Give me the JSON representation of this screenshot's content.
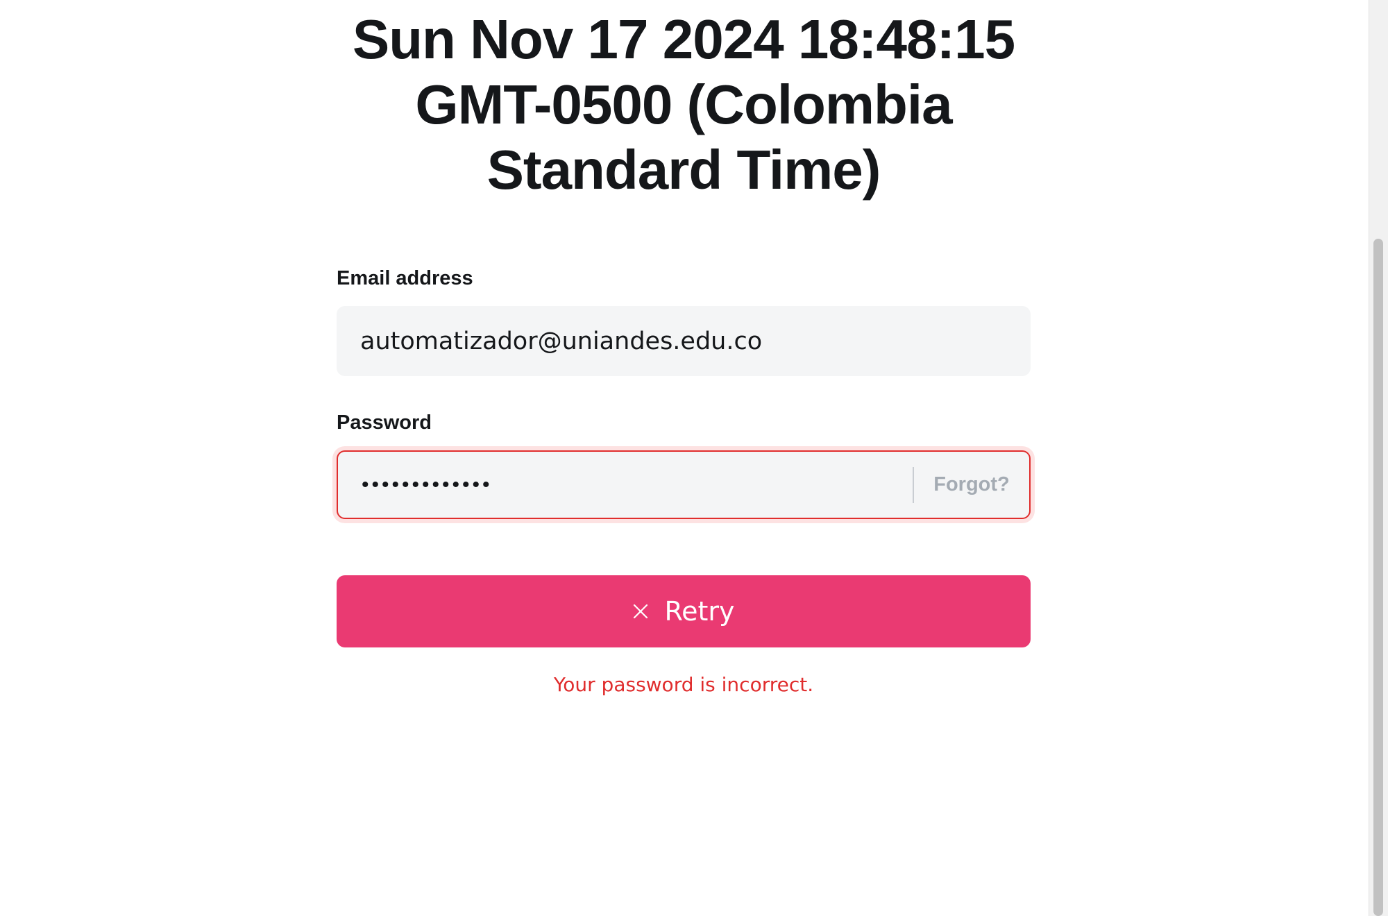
{
  "header": {
    "datetime": "Sun Nov 17 2024 18:48:15 GMT-0500 (Colombia Standard Time)"
  },
  "form": {
    "email_label": "Email address",
    "email_value": "automatizador@uniandes.edu.co",
    "password_label": "Password",
    "password_value": "•••••••••••••",
    "forgot_label": "Forgot?",
    "retry_label": "Retry",
    "retry_icon": "close-icon",
    "error_message": "Your password is incorrect."
  },
  "colors": {
    "accent": "#ea3a72",
    "error": "#e02d2d",
    "input_bg": "#f4f5f6",
    "text": "#15171a"
  }
}
